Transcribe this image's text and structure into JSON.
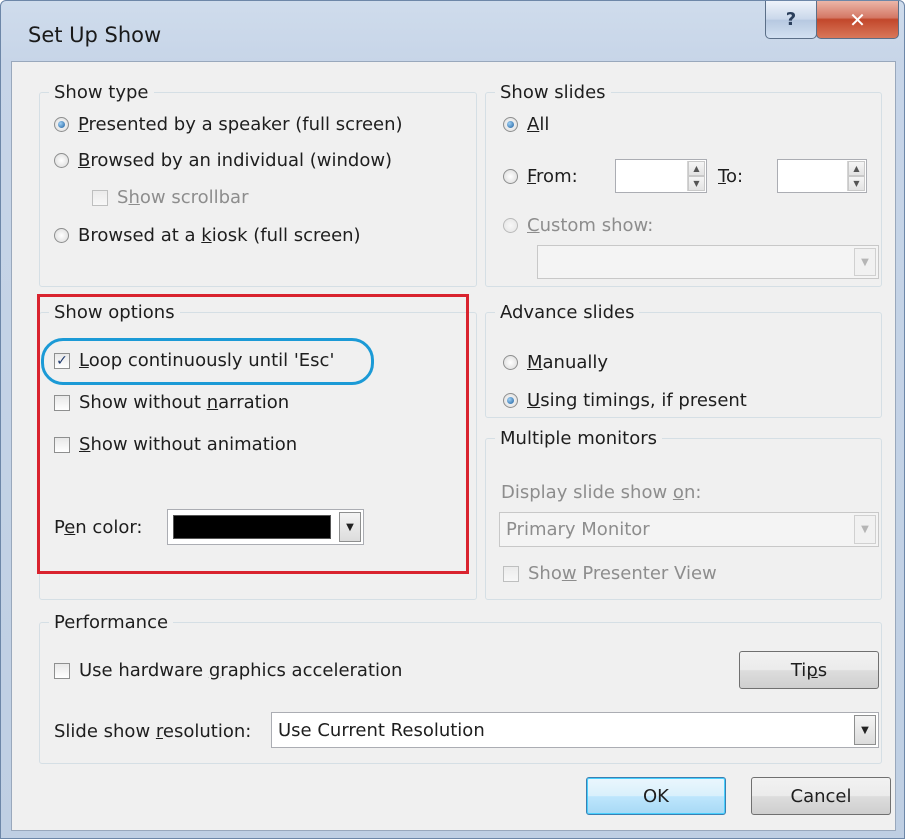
{
  "window": {
    "title": "Set Up Show",
    "help_label": "?",
    "close_label": "✕"
  },
  "show_type": {
    "legend": "Show type",
    "option1": {
      "pre": "",
      "u": "P",
      "post": "resented by a speaker (full screen)"
    },
    "option2": {
      "pre": "",
      "u": "B",
      "post": "rowsed by an individual (window)"
    },
    "scrollbar": {
      "pre": "S",
      "u": "h",
      "post": "ow scrollbar"
    },
    "option3": {
      "pre": "Browsed at a ",
      "u": "k",
      "post": "iosk (full screen)"
    }
  },
  "show_slides": {
    "legend": "Show slides",
    "all": {
      "u": "A",
      "post": "ll"
    },
    "from": {
      "u": "F",
      "post": "rom:"
    },
    "to": {
      "u": "T",
      "post": "o:"
    },
    "from_value": "",
    "to_value": "",
    "custom": {
      "u": "C",
      "post": "ustom show:"
    },
    "custom_value": ""
  },
  "show_options": {
    "legend": "Show options",
    "loop": {
      "u": "L",
      "post": "oop continuously until 'Esc'"
    },
    "narration": {
      "pre": "Show without ",
      "u": "n",
      "post": "arration"
    },
    "animation": {
      "u": "S",
      "post": "how without animation"
    },
    "pen_label": {
      "pre": "P",
      "u": "e",
      "post": "n color:"
    },
    "pen_color": "#000000"
  },
  "advance_slides": {
    "legend": "Advance slides",
    "manually": {
      "u": "M",
      "post": "anually"
    },
    "timings": {
      "u": "U",
      "post": "sing timings, if present"
    }
  },
  "multiple_monitors": {
    "legend": "Multiple monitors",
    "display_label": {
      "pre": "Display slide show ",
      "u": "o",
      "post": "n:"
    },
    "monitor_value": "Primary Monitor",
    "presenter": {
      "pre": "Sho",
      "u": "w",
      "post": " Presenter View"
    }
  },
  "performance": {
    "legend": "Performance",
    "hardware": {
      "pre": "Use hardware ",
      "u": "g",
      "post": "raphics acceleration"
    },
    "tips": {
      "pre": "Ti",
      "u": "p",
      "post": "s"
    },
    "resolution_label": {
      "pre": "Slide show ",
      "u": "r",
      "post": "esolution:"
    },
    "resolution_value": "Use Current Resolution"
  },
  "buttons": {
    "ok": "OK",
    "cancel": "Cancel"
  },
  "colors": {
    "highlight_red": "#d9232e",
    "highlight_blue": "#1b9ad6"
  }
}
